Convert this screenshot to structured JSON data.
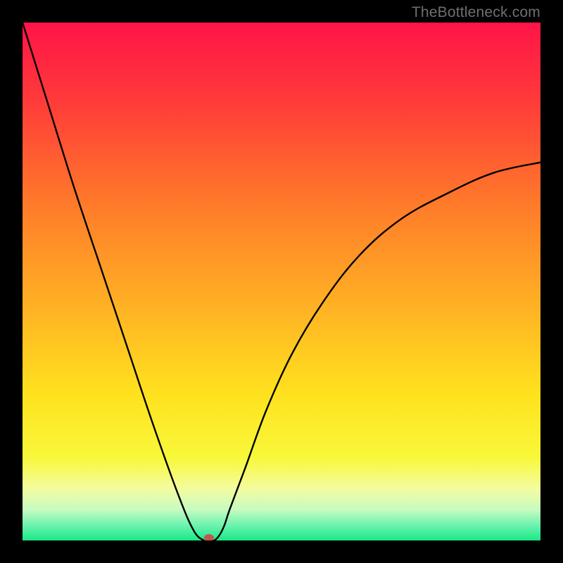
{
  "attribution": "TheBottleneck.com",
  "chart_data": {
    "type": "line",
    "title": "",
    "xlabel": "",
    "ylabel": "",
    "xlim": [
      0,
      100
    ],
    "ylim": [
      0,
      100
    ],
    "x": [
      0,
      5,
      10,
      15,
      20,
      25,
      30,
      33,
      35,
      36,
      37,
      38,
      39,
      40,
      43,
      47,
      52,
      58,
      65,
      73,
      82,
      91,
      100
    ],
    "values": [
      100,
      84,
      68,
      53,
      38,
      23,
      9,
      2,
      0,
      0,
      0,
      1,
      3,
      6,
      14,
      25,
      36,
      46,
      55,
      62,
      67,
      71,
      73
    ],
    "minimum_marker": {
      "x": 36,
      "y": 0
    },
    "background_gradient_stops": [
      {
        "offset": 0.0,
        "color": "#ff1447"
      },
      {
        "offset": 0.15,
        "color": "#ff3a3a"
      },
      {
        "offset": 0.35,
        "color": "#ff7a2a"
      },
      {
        "offset": 0.55,
        "color": "#ffb224"
      },
      {
        "offset": 0.72,
        "color": "#ffe21e"
      },
      {
        "offset": 0.84,
        "color": "#f8f83a"
      },
      {
        "offset": 0.9,
        "color": "#f3fca0"
      },
      {
        "offset": 0.94,
        "color": "#c8fbc0"
      },
      {
        "offset": 0.97,
        "color": "#6ef3b0"
      },
      {
        "offset": 1.0,
        "color": "#18e886"
      }
    ],
    "marker_color": "#c2554f",
    "curve_color": "#000000"
  }
}
